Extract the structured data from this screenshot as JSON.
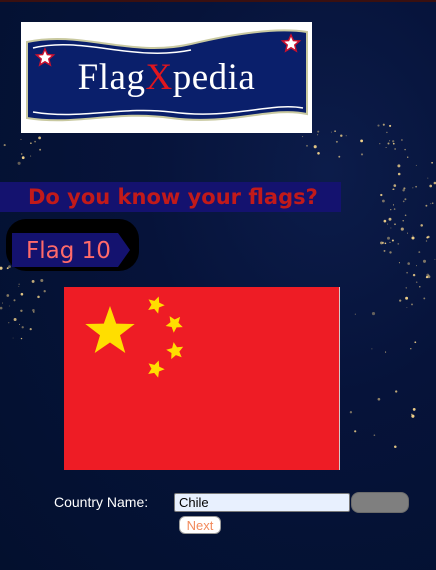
{
  "logo": {
    "text_before": "Flag",
    "text_x": "X",
    "text_after": "pedia"
  },
  "tagline": "Do you know your flags?",
  "flag_badge": {
    "label": "Flag 10"
  },
  "flag_image": {
    "country_depicted": "china-flag-image"
  },
  "form": {
    "country_label": "Country Name:",
    "country_value": "Chile",
    "submit_label": "",
    "next_label": "Next"
  },
  "colors": {
    "page_bg": "#06133a",
    "tagline_bar": "#14126f",
    "tagline_text": "#c21a1a",
    "flag_label_text": "#ff6a6a",
    "flag_red": "#ee1c25",
    "flag_star": "#ffde00",
    "logo_blue": "#0a1f6b",
    "next_text": "#f28a5c"
  }
}
